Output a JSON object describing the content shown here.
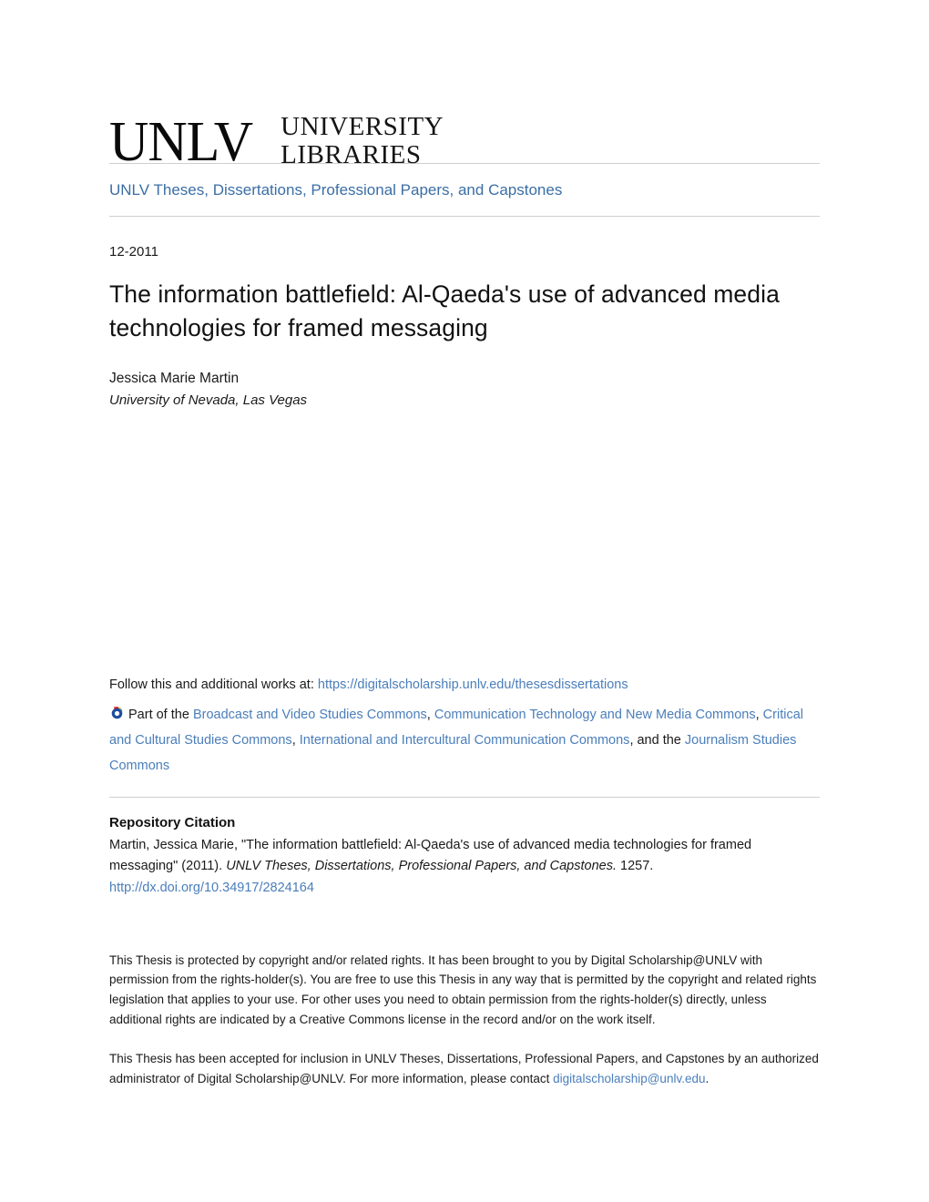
{
  "logo": {
    "mark": "UNLV",
    "line1": "UNIVERSITY",
    "line2": "LIBRARIES",
    "alt": "UNLV University Libraries"
  },
  "breadcrumb": {
    "label": "UNLV Theses, Dissertations, Professional Papers, and Capstones"
  },
  "record": {
    "pubdate": "12-2011",
    "title": "The information battlefield: Al-Qaeda's use of advanced media technologies for framed messaging",
    "author": "Jessica Marie Martin",
    "affiliation": "University of Nevada, Las Vegas"
  },
  "follow": {
    "prefix": "Follow this and additional works at:",
    "url": "https://digitalscholarship.unlv.edu/thesesdissertations",
    "part_of": "Part of the",
    "and_the": ", and the",
    "subjects": [
      "Broadcast and Video Studies Commons",
      "Communication Technology and New Media Commons",
      "Critical and Cultural Studies Commons",
      "International and Intercultural Communication Commons",
      "Journalism Studies Commons"
    ],
    "icon": "digital-commons-network-icon"
  },
  "citation": {
    "heading": "Repository Citation",
    "text_1": "Martin, Jessica Marie, \"The information battlefield: Al-Qaeda's use of advanced media technologies for framed messaging\" (2011). ",
    "series_italic": "UNLV Theses, Dissertations, Professional Papers, and Capstones.",
    "text_2": " 1257.",
    "doi_url": "http://dx.doi.org/10.34917/2824164"
  },
  "rights": {
    "paragraph_1": "This Thesis is protected by copyright and/or related rights. It has been brought to you by Digital Scholarship@UNLV with permission from the rights-holder(s). You are free to use this Thesis in any way that is permitted by the copyright and related rights legislation that applies to your use. For other uses you need to obtain permission from the rights-holder(s) directly, unless additional rights are indicated by a Creative Commons license in the record and/or on the work itself.",
    "paragraph_2_before": "This Thesis has been accepted for inclusion in UNLV Theses, Dissertations, Professional Papers, and Capstones by an authorized administrator of Digital Scholarship@UNLV. For more information, please contact ",
    "contact_email": "digitalscholarship@unlv.edu",
    "paragraph_2_after": "."
  },
  "colors": {
    "link_blue": "#4a7ebb",
    "breadcrumb_blue": "#3a6ea5",
    "rule_gray": "#cfcfcf",
    "text_black": "#1a1a1a"
  }
}
